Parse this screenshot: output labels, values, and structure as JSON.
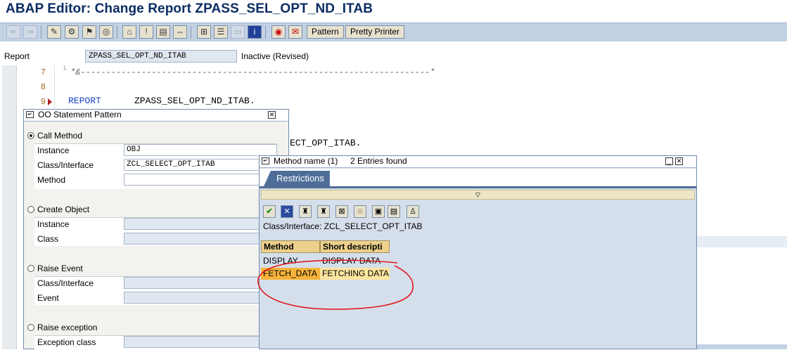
{
  "window": {
    "title": "ABAP Editor: Change Report ZPASS_SEL_OPT_ND_ITAB"
  },
  "toolbar": {
    "icons": [
      "back-icon",
      "forward-icon",
      "display-change-icon",
      "other-object-icon",
      "activate-icon",
      "check-icon",
      "test-icon",
      "where-used-icon",
      "object-list-icon",
      "stack-icon",
      "enhance-icon",
      "breakpoint-icon",
      "upload-icon",
      "navigate-icon",
      "download-icon",
      "info-icon",
      "pattern-icon",
      "pretty-printer-icon"
    ],
    "pattern_label": "Pattern",
    "pretty_printer_label": "Pretty Printer"
  },
  "header": {
    "report_label": "Report",
    "report_value": "ZPASS_SEL_OPT_ND_ITAB",
    "status": "Inactive (Revised)"
  },
  "editor": {
    "lines": [
      {
        "num": "7",
        "text": "*&---------------------------------------------------------------------*"
      },
      {
        "num": "8",
        "text": ""
      },
      {
        "num": "9",
        "keyword": "REPORT",
        "text": "ZPASS_SEL_OPT_ND_ITAB."
      }
    ],
    "hidden_line_fragment": "ECT_OPT_ITAB."
  },
  "oo_dialog": {
    "title": "OO Statement Pattern",
    "call_method": {
      "label": "Call Method",
      "selected": true,
      "instance_label": "Instance",
      "instance_value": "OBJ",
      "class_label": "Class/Interface",
      "class_value": "ZCL_SELECT_OPT_ITAB",
      "method_label": "Method",
      "method_value": ""
    },
    "create_object": {
      "label": "Create Object",
      "instance_label": "Instance",
      "class_label": "Class"
    },
    "raise_event": {
      "label": "Raise Event",
      "class_label": "Class/Interface",
      "event_label": "Event"
    },
    "raise_exception": {
      "label": "Raise exception",
      "class_label": "Exception class"
    }
  },
  "method_dialog": {
    "title": "Method name (1)",
    "entries_found": "2 Entries found",
    "tab_label": "Restrictions",
    "collapse_symbol": "▽",
    "class_line": "Class/Interface: ZCL_SELECT_OPT_ITAB",
    "columns": [
      "Method",
      "Short descripti"
    ],
    "rows": [
      {
        "method": "DISPLAY",
        "description": "DISPLAY DATA",
        "selected": false
      },
      {
        "method": "FETCH_DATA",
        "description": "FETCHING DATA",
        "selected": true
      }
    ],
    "toolbar_icons": [
      "ok-check-icon",
      "cancel-icon",
      "find-icon",
      "find-next-icon",
      "sort-icon",
      "new-search-icon",
      "print-icon",
      "personalize-icon"
    ]
  },
  "annotation": {
    "color": "#e0191c"
  }
}
